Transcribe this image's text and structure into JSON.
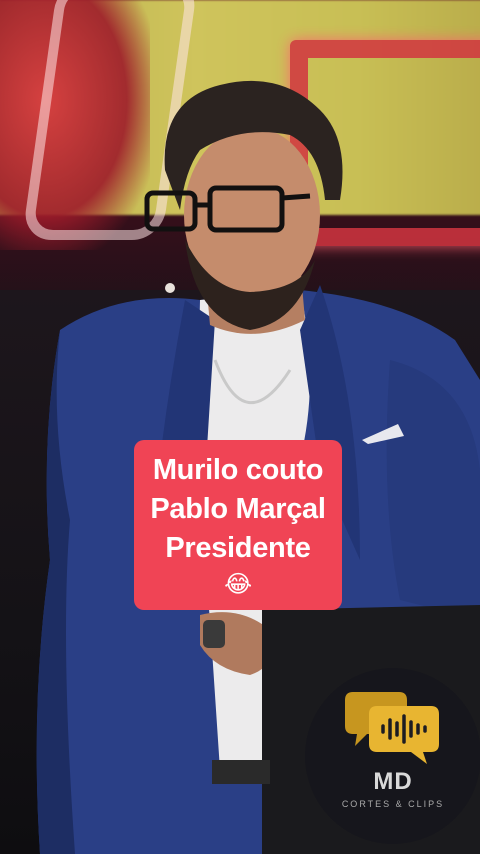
{
  "caption": {
    "line1": "Murilo couto",
    "line2": "Pablo Marçal",
    "line3": "Presidente",
    "emoji": "😂",
    "background_color": "#f04455"
  },
  "watermark": {
    "logo_text": "MD",
    "subtitle": "CORTES & CLIPS",
    "icon": "speech-bubbles-soundwave-icon",
    "accent_color": "#e8b531"
  },
  "scene": {
    "icon": "stage-speaker-photo"
  }
}
